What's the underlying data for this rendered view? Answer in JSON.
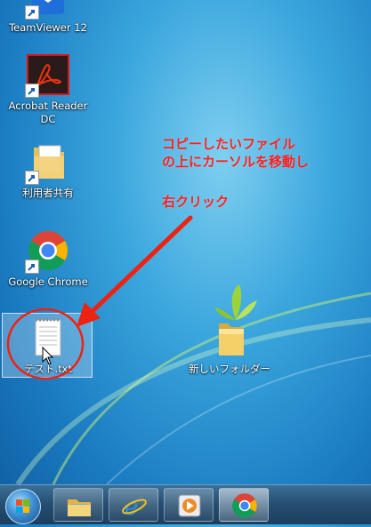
{
  "desktop": {
    "icons": [
      {
        "label": "TeamViewer 12"
      },
      {
        "label": "Acrobat Reader DC"
      },
      {
        "label": "利用者共有"
      },
      {
        "label": "Google Chrome"
      },
      {
        "label": "テスト.txt"
      },
      {
        "label": "新しいフォルダー"
      }
    ]
  },
  "annotation": {
    "line1": "コピーしたいファイル",
    "line2": "の上にカーソルを移動し",
    "line3": "右クリック",
    "color": "#ff1e1e"
  },
  "taskbar": {
    "items": [
      "start-orb",
      "explorer-icon",
      "internet-explorer-icon",
      "media-player-icon",
      "chrome-icon"
    ]
  }
}
